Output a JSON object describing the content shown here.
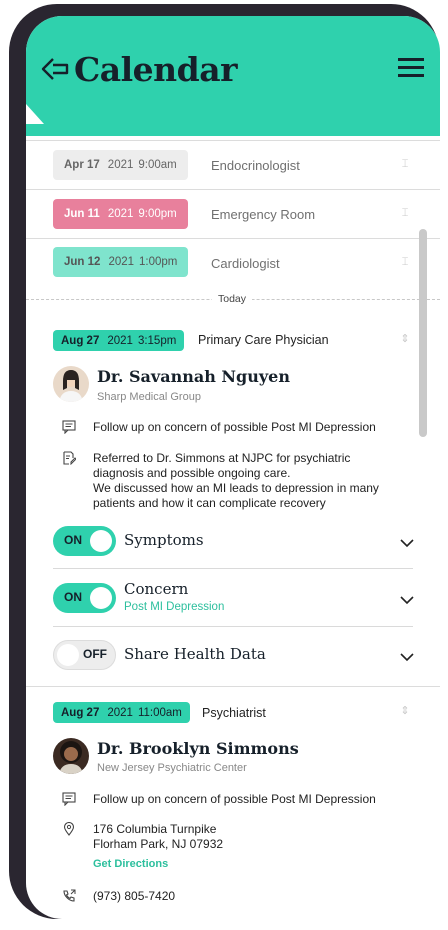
{
  "header": {
    "title": "Calendar"
  },
  "past_appointments": [
    {
      "month_day": "Apr 17",
      "year": "2021",
      "time": "9:00am",
      "title": "Endocrinologist"
    },
    {
      "month_day": "Jun 11",
      "year": "2021",
      "time": "9:00pm",
      "title": "Emergency Room"
    },
    {
      "month_day": "Jun 12",
      "year": "2021",
      "time": "1:00pm",
      "title": "Cardiologist"
    }
  ],
  "today_label": "Today",
  "appointment1": {
    "month_day": "Aug 27",
    "year": "2021",
    "time": "3:15pm",
    "title": "Primary Care Physician",
    "doctor": "Dr. Savannah Nguyen",
    "org": "Sharp Medical Group",
    "note": "Follow up on concern of possible Post MI Depression",
    "referral": [
      "Referred to Dr. Simmons at NJPC for psychiatric",
      "diagnosis and possible ongoing care.",
      "We discussed how an MI leads to depression in many",
      "patients and how it can complicate recovery"
    ],
    "toggles": [
      {
        "state": "ON",
        "label": "Symptoms",
        "sub": ""
      },
      {
        "state": "ON",
        "label": "Concern",
        "sub": "Post MI Depression"
      },
      {
        "state": "OFF",
        "label": "Share Health Data",
        "sub": ""
      }
    ]
  },
  "appointment2": {
    "month_day": "Aug 27",
    "year": "2021",
    "time": "11:00am",
    "title": "Psychiatrist",
    "doctor": "Dr. Brooklyn Simmons",
    "org": "New Jersey Psychiatric Center",
    "note": "Follow up on concern of possible Post MI Depression",
    "address_line1": "176 Columbia Turnpike",
    "address_line2": "Florham Park, NJ 07932",
    "directions": "Get Directions",
    "phone": "(973) 805-7420"
  },
  "colors": {
    "accent": "#2fd1ad",
    "pink": "#e8809c",
    "pill_gray": "#ededed",
    "pale_teal": "#7fe4cd"
  }
}
